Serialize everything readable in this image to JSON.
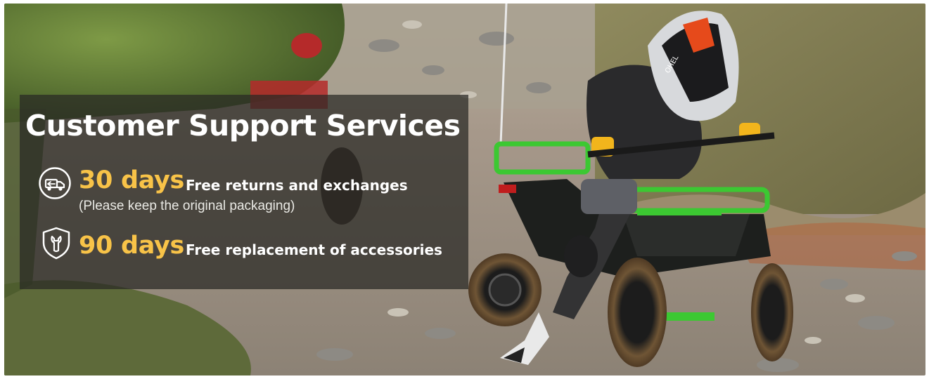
{
  "banner": {
    "headline": "Customer Support Services",
    "accent_color": "#f8c348",
    "offers": [
      {
        "icon": "truck-returns-icon",
        "days": "30 days",
        "title": "Free returns and exchanges",
        "note": "(Please keep the original packaging)"
      },
      {
        "icon": "shield-wrench-icon",
        "days": "90 days",
        "title": "Free replacement of accessories"
      }
    ],
    "photo": {
      "subject": "quad-bike-rider-photo",
      "quad_color": "#3cc832",
      "helmet_brand": "OHEL"
    }
  }
}
